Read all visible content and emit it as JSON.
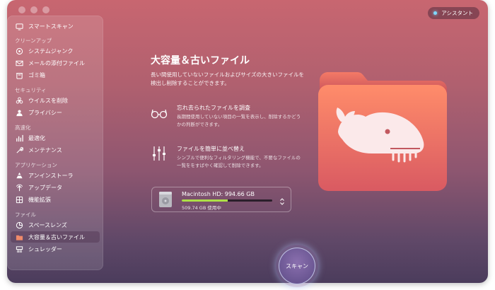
{
  "sidebar": {
    "items": [
      {
        "label": "スマートスキャン",
        "icon": "smart-scan-icon",
        "active": false
      },
      {
        "label": "システムジャンク",
        "icon": "system-junk-icon",
        "active": false
      },
      {
        "label": "メールの添付ファイル",
        "icon": "mail-icon",
        "active": false
      },
      {
        "label": "ゴミ箱",
        "icon": "trash-icon",
        "active": false
      },
      {
        "label": "ウイルスを削除",
        "icon": "biohazard-icon",
        "active": false
      },
      {
        "label": "プライバシー",
        "icon": "privacy-icon",
        "active": false
      },
      {
        "label": "最適化",
        "icon": "optimization-icon",
        "active": false
      },
      {
        "label": "メンテナンス",
        "icon": "maintenance-icon",
        "active": false
      },
      {
        "label": "アンインストーラ",
        "icon": "uninstaller-icon",
        "active": false
      },
      {
        "label": "アップデータ",
        "icon": "updater-icon",
        "active": false
      },
      {
        "label": "機能拡張",
        "icon": "extensions-icon",
        "active": false
      },
      {
        "label": "スペースレンズ",
        "icon": "space-lens-icon",
        "active": false
      },
      {
        "label": "大容量＆古いファイル",
        "icon": "folder-icon",
        "active": true
      },
      {
        "label": "シュレッダー",
        "icon": "shredder-icon",
        "active": false
      }
    ],
    "sections": {
      "cleanup": "クリーンアップ",
      "security": "セキュリティ",
      "speed": "高速化",
      "applications": "アプリケーション",
      "files": "ファイル"
    }
  },
  "assistant": {
    "label": "アシスタント"
  },
  "main": {
    "title": "大容量＆古いファイル",
    "description": "長い間使用していないファイルおよびサイズの大きいファイルを検出し削除することができます。",
    "features": [
      {
        "title": "忘れ去られたファイルを調査",
        "description": "長期間使用していない項目の一覧を表示し、削除するかどうかの判断ができます。",
        "icon": "glasses-icon"
      },
      {
        "title": "ファイルを簡単に並べ替え",
        "description": "シンプルで便利なフィルタリング機能で、不要なファイルの一覧ををすばやく確認して削除できます。",
        "icon": "sliders-icon"
      }
    ],
    "disk": {
      "name": "Macintosh HD: 994.66 GB",
      "usage": "509.74 GB 使用中",
      "used_fraction": 0.51
    },
    "scan_label": "スキャン"
  },
  "colors": {
    "accent_bar": "#aee047",
    "folder": "#e86a5c",
    "assistant_dot": "#7fd8ff"
  }
}
